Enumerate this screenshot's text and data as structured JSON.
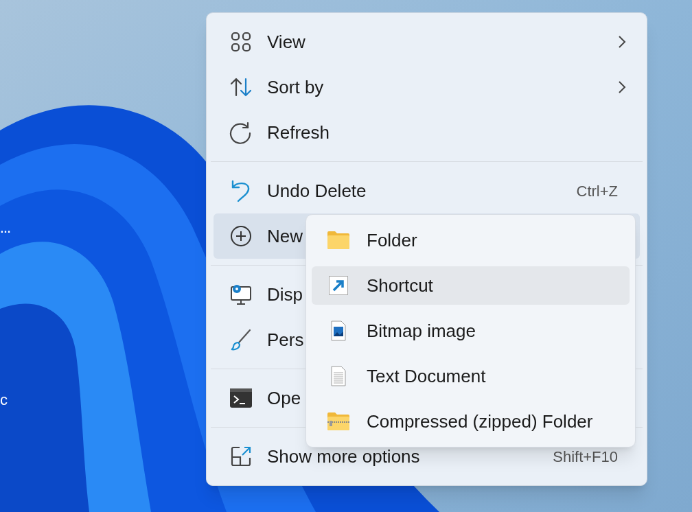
{
  "desktop": {
    "icon_labels": [
      "…",
      "c"
    ]
  },
  "context_menu": {
    "items": [
      {
        "kind": "item",
        "label": "View",
        "has_submenu": true,
        "selected": false
      },
      {
        "kind": "item",
        "label": "Sort by",
        "has_submenu": true,
        "selected": false
      },
      {
        "kind": "item",
        "label": "Refresh",
        "has_submenu": false,
        "selected": false
      },
      {
        "kind": "separator"
      },
      {
        "kind": "item",
        "label": "Undo Delete",
        "shortcut": "Ctrl+Z",
        "has_submenu": false,
        "selected": false
      },
      {
        "kind": "item",
        "label": "New",
        "has_submenu": false,
        "selected": true
      },
      {
        "kind": "separator"
      },
      {
        "kind": "item",
        "label": "Disp",
        "has_submenu": false,
        "selected": false
      },
      {
        "kind": "item",
        "label": "Pers",
        "has_submenu": false,
        "selected": false
      },
      {
        "kind": "separator"
      },
      {
        "kind": "item",
        "label": "Ope",
        "has_submenu": false,
        "selected": false
      },
      {
        "kind": "separator"
      },
      {
        "kind": "item",
        "label": "Show more options",
        "shortcut": "Shift+F10",
        "has_submenu": false,
        "selected": false
      }
    ]
  },
  "submenu": {
    "items": [
      {
        "label": "Folder",
        "selected": false
      },
      {
        "label": "Shortcut",
        "selected": true
      },
      {
        "label": "Bitmap image",
        "selected": false
      },
      {
        "label": "Text Document",
        "selected": false
      },
      {
        "label": "Compressed (zipped) Folder",
        "selected": false
      }
    ]
  }
}
